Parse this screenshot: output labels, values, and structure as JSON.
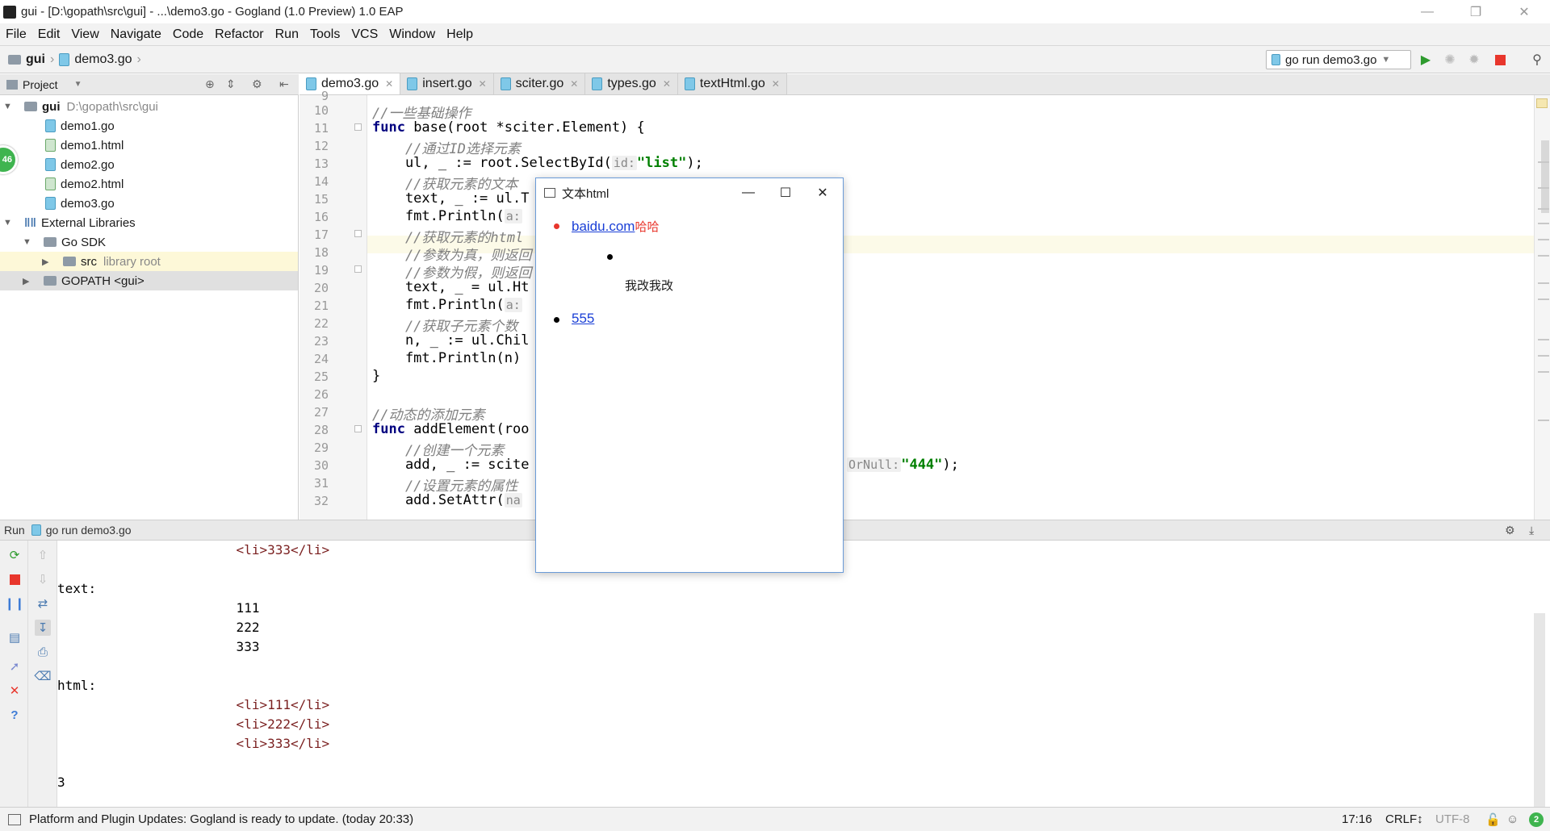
{
  "window": {
    "title": "gui - [D:\\gopath\\src\\gui] - ...\\demo3.go - Gogland (1.0 Preview) 1.0 EAP",
    "icons": [
      "app-icon",
      "minimize-icon",
      "restore-icon",
      "close-icon"
    ]
  },
  "menu": [
    "File",
    "Edit",
    "View",
    "Navigate",
    "Code",
    "Refactor",
    "Run",
    "Tools",
    "VCS",
    "Window",
    "Help"
  ],
  "breadcrumb": {
    "project": "gui",
    "file": "demo3.go"
  },
  "toolbar": {
    "run_config": "go run demo3.go"
  },
  "project_panel": {
    "title": "Project",
    "root_name": "gui",
    "root_path": "D:\\gopath\\src\\gui",
    "files": [
      "demo1.go",
      "demo1.html",
      "demo2.go",
      "demo2.html",
      "demo3.go"
    ],
    "external_libraries": "External Libraries",
    "go_sdk": "Go SDK",
    "src_label": "src",
    "src_muted": "library root",
    "gopath": "GOPATH <gui>",
    "badge": "46"
  },
  "tabs": [
    "demo3.go",
    "insert.go",
    "sciter.go",
    "types.go",
    "textHtml.go"
  ],
  "editor": {
    "first_line": "9",
    "lines": [
      {
        "n": "10",
        "c": "//一些基础操作"
      },
      {
        "n": "11",
        "k": "func",
        "t": " base(root *sciter.Element) {"
      },
      {
        "n": "12",
        "c": "    //通过ID选择元素"
      },
      {
        "n": "13",
        "t": "    ul, _ := root.SelectById(",
        "h": "id:",
        "s": "\"list\"",
        "t2": ");"
      },
      {
        "n": "14",
        "c": "    //获取元素的文本"
      },
      {
        "n": "15",
        "t": "    text, _ := ul.T"
      },
      {
        "n": "16",
        "t": "    fmt.Println(",
        "h": "a:"
      },
      {
        "n": "17",
        "c": "    //获取元素的html"
      },
      {
        "n": "18",
        "c": "    //参数为真，则返回"
      },
      {
        "n": "19",
        "c": "    //参数为假，则返回"
      },
      {
        "n": "20",
        "t": "    text, _ = ul.Ht"
      },
      {
        "n": "21",
        "t": "    fmt.Println(",
        "h": "a:"
      },
      {
        "n": "22",
        "c": "    //获取子元素个数"
      },
      {
        "n": "23",
        "t": "    n, _ := ul.Chil"
      },
      {
        "n": "24",
        "t": "    fmt.Println(n)"
      },
      {
        "n": "25",
        "t": "}"
      },
      {
        "n": "26",
        "t": ""
      },
      {
        "n": "27",
        "c": "//动态的添加元素"
      },
      {
        "n": "28",
        "k": "func",
        "t": " addElement(roo"
      },
      {
        "n": "29",
        "c": "    //创建一个元素"
      },
      {
        "n": "30",
        "t": "    add, _ := scite"
      },
      {
        "n": "31",
        "c": "    //设置元素的属性"
      },
      {
        "n": "32",
        "t": "    add.SetAttr(",
        "h": "na"
      }
    ],
    "line30_hint": "OrNull:",
    "line30_str": "\"444\"",
    "line30_end": ");"
  },
  "run_panel": {
    "label": "Run",
    "config": "go run demo3.go",
    "output": [
      "                       <li>333</li>",
      "",
      "text:",
      "                       111",
      "                       222",
      "                       333",
      "",
      "html:",
      "                       <li>111</li>",
      "                       <li>222</li>",
      "                       <li>333</li>",
      "",
      "3"
    ]
  },
  "popup": {
    "title": "文本html",
    "link1": "baidu.com",
    "link1_suffix": "哈哈",
    "text": "我改我改",
    "link2": "555"
  },
  "status": {
    "message": "Platform and Plugin Updates: Gogland is ready to update. (today 20:33)",
    "position": "17:16",
    "line_sep": "CRLF↕",
    "encoding": "UTF-8",
    "badge": "2"
  },
  "colors": {
    "accent_red": "#e8362c",
    "link_blue": "#1a3fd6",
    "run_green": "#2e9b2e",
    "current_line": "#fcfae8"
  }
}
